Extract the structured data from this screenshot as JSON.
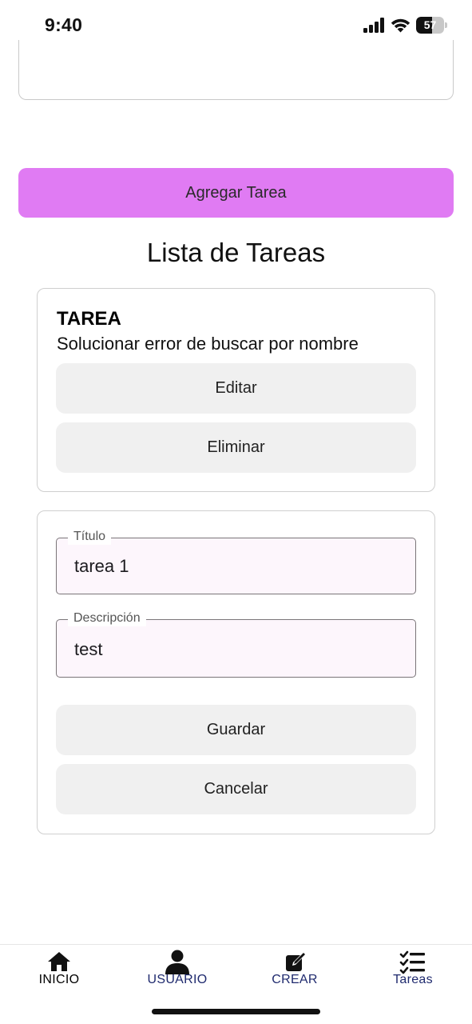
{
  "status_bar": {
    "time": "9:40",
    "battery_level": "57",
    "battery_fraction": 0.57,
    "icons": [
      "cellular-signal-icon",
      "wifi-icon",
      "battery-icon"
    ]
  },
  "form": {
    "add_button_label": "Agregar Tarea"
  },
  "task_list": {
    "title": "Lista de Tareas",
    "task": {
      "heading": "TAREA",
      "description": "Solucionar error de buscar por nombre",
      "edit_label": "Editar",
      "delete_label": "Eliminar"
    }
  },
  "edit_form": {
    "title_label": "Título",
    "title_value": "tarea 1",
    "description_label": "Descripción",
    "description_value": "test",
    "save_label": "Guardar",
    "cancel_label": "Cancelar"
  },
  "bottom_nav": {
    "items": [
      {
        "label": "INICIO",
        "icon": "home-icon"
      },
      {
        "label": "USUARIO",
        "icon": "user-icon"
      },
      {
        "label": "CREAR",
        "icon": "edit-icon"
      },
      {
        "label": "Tareas",
        "icon": "task-list-icon"
      }
    ]
  },
  "colors": {
    "accent_button": "#e07bf3",
    "nav_active_text": "#1f2a6e",
    "nav_inactive_text": "#000000",
    "field_background": "#fdf6fc"
  }
}
